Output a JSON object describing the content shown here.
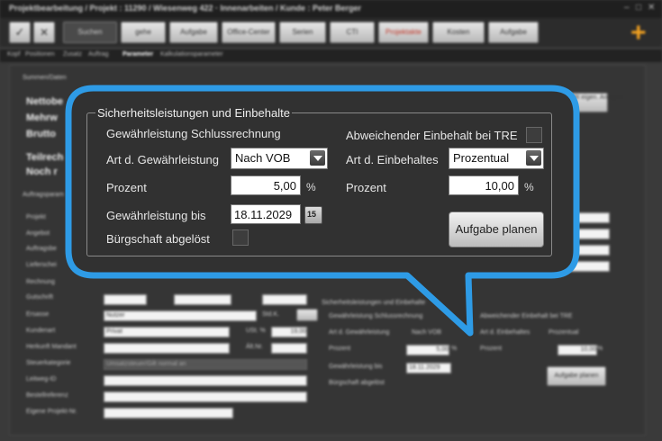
{
  "window": {
    "title": "Projektbearbeitung / Projekt : 11290 / Wiesenweg 422 · Innenarbeiten / Kunde : Peter Berger"
  },
  "toolbar": {
    "buttons": [
      "Suchen",
      "Aufgabe",
      "Office-Center",
      "Serien",
      "CTI",
      "Kosten",
      "Aufgabe"
    ],
    "red_button": "Projektakte",
    "dim_button": "gehe"
  },
  "tabs": [
    "Kopf",
    "Positionen",
    "Zusatz",
    "Auftrag",
    "Parameter",
    "Kalkulationsparameter"
  ],
  "background": {
    "section_summen": "Summen/Daten",
    "totals": [
      "Nettobe",
      "Mehrw",
      "Brutto",
      "Teilrech",
      "Noch r"
    ],
    "auftragsparam": "Auftragsparam",
    "rows": [
      "Projekt",
      "Angebot",
      "Auftragsbe",
      "Lieferschei",
      "Rechnung",
      "Gutschrift",
      "Ersasse",
      "Kundenart",
      "Herkunft Mandant",
      "Steuerkategorie",
      "Leitweg-ID",
      "Bestellreferenz",
      "Eigene Projekt-Nr."
    ],
    "ersasse_value": "Nutzer",
    "kundenart_value": "Privat",
    "ust_label": "USt. %",
    "ust_value": "19,00",
    "steuer_value": "Umsatzsteuer/Gilt normal an",
    "std_label": "Std.K.",
    "aen_label": "Ält.Nr.",
    "side_btn": "Mit eigen. Anlagen",
    "sub": {
      "title": "Sicherheitsleistungen und Einbehalte",
      "gewaehr_schluss": "Gewährleistung Schlussrechnung",
      "art_gew": "Art d. Gewährleistung",
      "art_gew_val": "Nach VOB",
      "prozent": "Prozent",
      "prozent_val": "5,00",
      "gew_bis": "Gewährleistung bis",
      "gew_bis_val": "18.11.2029",
      "buergschaft": "Bürgschaft abgelöst",
      "abw": "Abweichender Einbehalt bei TRE",
      "art_einb": "Art d. Einbehaltes",
      "art_einb_val": "Prozentual",
      "prozent2_val": "10,00",
      "unit": "%",
      "plan": "Aufgabe planen"
    }
  },
  "callout": {
    "legend": "Sicherheitsleistungen und Einbehalte",
    "gewaehrleistung_schluss": "Gewährleistung Schlussrechnung",
    "art_gewaehrleistung_label": "Art d. Gewährleistung",
    "art_gewaehrleistung_value": "Nach VOB",
    "prozent_label": "Prozent",
    "prozent_value": "5,00",
    "percent_unit": "%",
    "gewaehrleistung_bis_label": "Gewährleistung bis",
    "gewaehrleistung_bis_value": "18.11.2029",
    "calendar_glyph": "15",
    "buergschaft_label": "Bürgschaft abgelöst",
    "abweichender_label": "Abweichender Einbehalt bei TRE",
    "art_einbehalt_label": "Art d. Einbehaltes",
    "art_einbehalt_value": "Prozentual",
    "prozent2_label": "Prozent",
    "prozent2_value": "10,00",
    "aufgabe_planen": "Aufgabe planen"
  },
  "colors": {
    "callout_border": "#2e9be6",
    "panel_bg": "#313131",
    "accent_plus": "#f0a020"
  },
  "icons": {
    "check": "check-icon",
    "close": "close-icon",
    "plus": "plus-icon",
    "calendar": "calendar-icon",
    "dropdown": "chevron-down-icon"
  }
}
